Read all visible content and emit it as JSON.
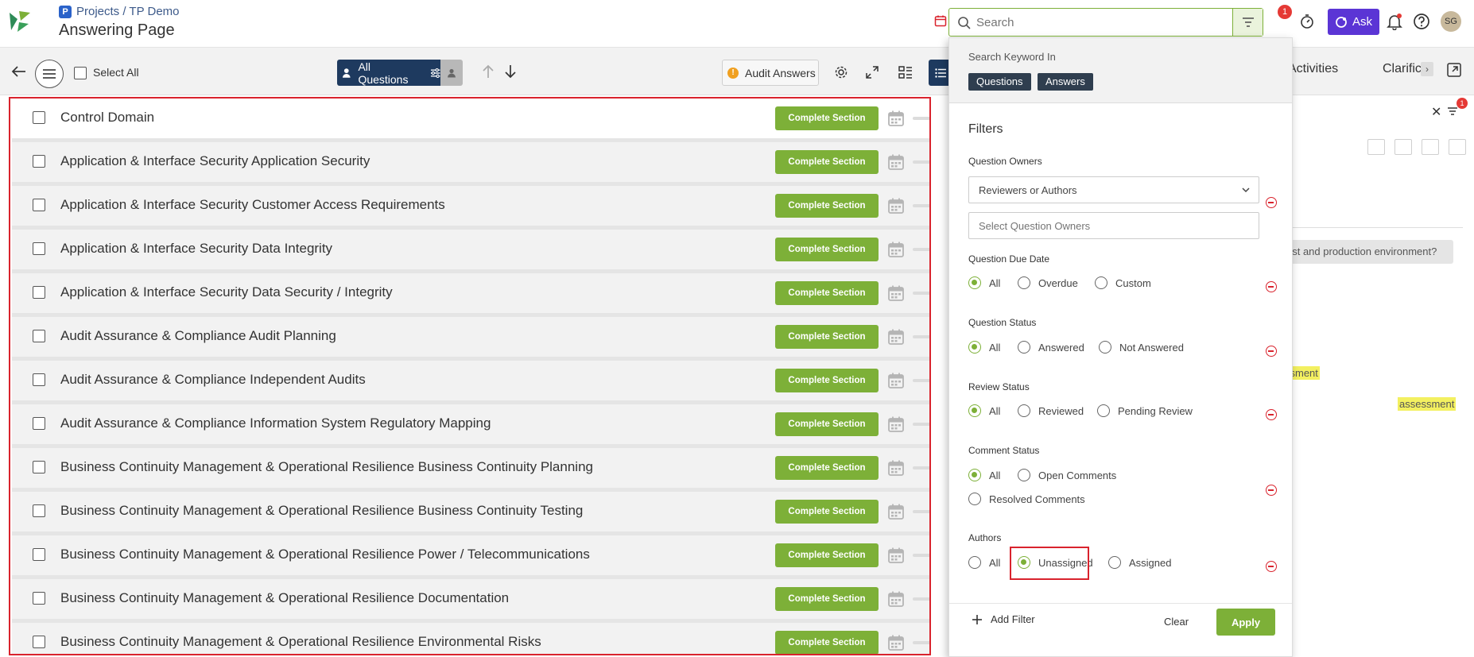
{
  "header": {
    "breadcrumb": "Projects / TP Demo",
    "title": "Answering Page",
    "search_placeholder": "Search",
    "filter_badge": "1",
    "ask_label": "Ask",
    "avatar_initials": "SG"
  },
  "toolbar": {
    "select_all": "Select All",
    "all_questions": "All Questions",
    "audit_answers": "Audit Answers"
  },
  "right_panel": {
    "tab_activities": "Activities",
    "tab_clarifications": "Clarific",
    "filter_badge": "1",
    "question_snippet": "est and production environment?",
    "highlight_1": "ssment",
    "highlight_2": "assessment"
  },
  "sections": {
    "complete_label": "Complete Section",
    "items": [
      "Control Domain",
      "Application & Interface Security Application Security",
      "Application & Interface Security Customer Access Requirements",
      "Application & Interface Security Data Integrity",
      "Application & Interface Security Data Security / Integrity",
      "Audit Assurance & Compliance Audit Planning",
      "Audit Assurance & Compliance Independent Audits",
      "Audit Assurance & Compliance Information System Regulatory Mapping",
      "Business Continuity Management & Operational Resilience Business Continuity Planning",
      "Business Continuity Management & Operational Resilience Business Continuity Testing",
      "Business Continuity Management & Operational Resilience Power / Telecommunications",
      "Business Continuity Management & Operational Resilience Documentation",
      "Business Continuity Management & Operational Resilience Environmental Risks"
    ]
  },
  "dropdown": {
    "keyword_label": "Search Keyword In",
    "kw_questions": "Questions",
    "kw_answers": "Answers",
    "filters_title": "Filters",
    "owners_label": "Question Owners",
    "owners_select": "Reviewers or Authors",
    "owners_placeholder": "Select Question Owners",
    "due_label": "Question Due Date",
    "due_options": [
      "All",
      "Overdue",
      "Custom"
    ],
    "status_label": "Question Status",
    "status_options": [
      "All",
      "Answered",
      "Not Answered"
    ],
    "review_label": "Review Status",
    "review_options": [
      "All",
      "Reviewed",
      "Pending Review"
    ],
    "comment_label": "Comment Status",
    "comment_options": [
      "All",
      "Open Comments",
      "Resolved Comments"
    ],
    "authors_label": "Authors",
    "authors_options": [
      "All",
      "Unassigned",
      "Assigned"
    ],
    "add_filter": "Add Filter",
    "clear": "Clear",
    "apply": "Apply"
  },
  "colors": {
    "accent_green": "#7db038",
    "navy": "#1e3a5f",
    "ask_purple": "#5b35d5",
    "alert_red": "#d9232d"
  }
}
